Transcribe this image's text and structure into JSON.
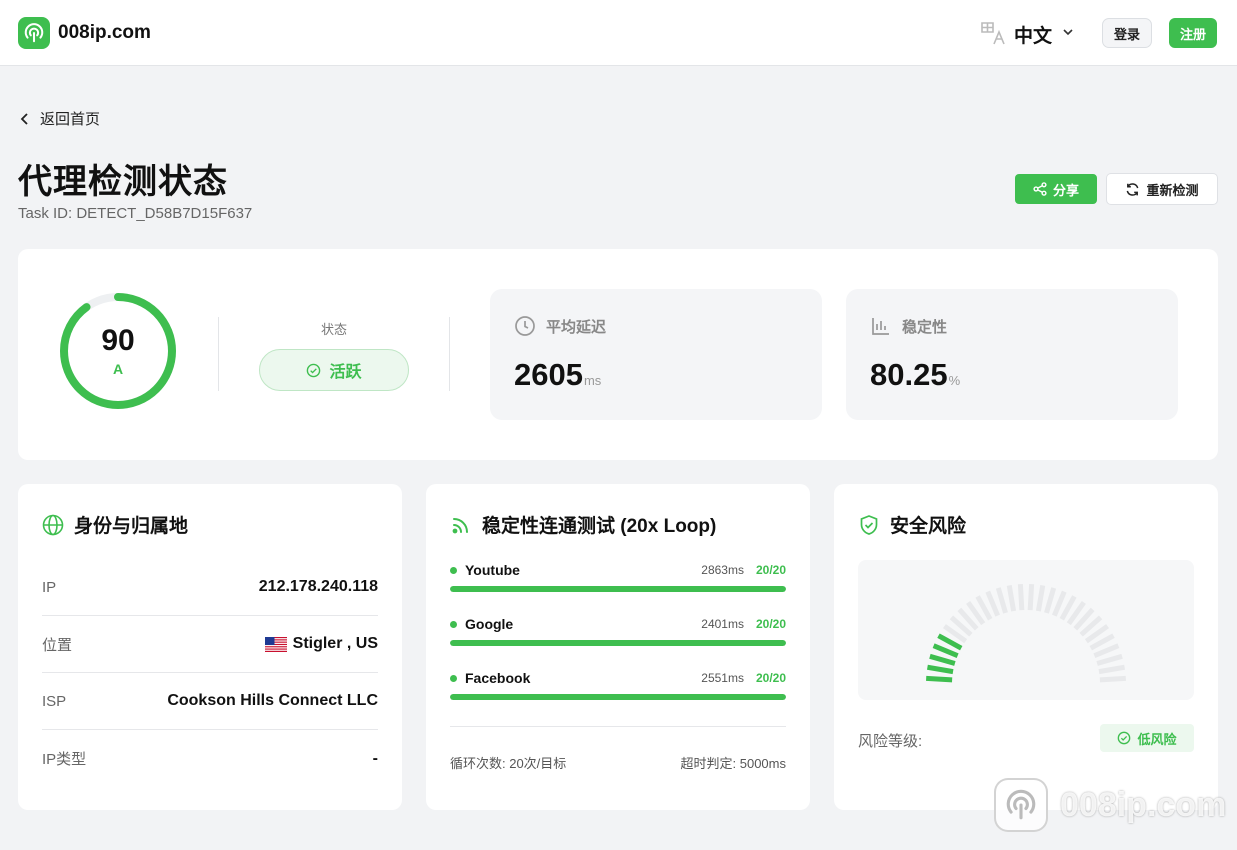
{
  "header": {
    "site_name": "008ip.com",
    "language": "中文",
    "login_label": "登录",
    "register_label": "注册"
  },
  "nav": {
    "back_label": "返回首页"
  },
  "page": {
    "title": "代理检测状态",
    "task_id": "Task ID: DETECT_D58B7D15F637",
    "share_label": "分享",
    "retest_label": "重新检测"
  },
  "summary": {
    "score": "90",
    "score_fraction": 0.9,
    "grade": "A",
    "status_label": "状态",
    "status_value": "活跃",
    "latency_label": "平均延迟",
    "latency_value": "2605",
    "latency_unit": "ms",
    "stability_label": "稳定性",
    "stability_value": "80.25",
    "stability_unit": "%"
  },
  "identity": {
    "title": "身份与归属地",
    "rows": [
      {
        "key": "IP",
        "value": "212.178.240.118"
      },
      {
        "key": "位置",
        "value": "Stigler , US"
      },
      {
        "key": "ISP",
        "value": "Cookson Hills Connect LLC"
      },
      {
        "key": "IP类型",
        "value": "-"
      }
    ]
  },
  "loop": {
    "title": "稳定性连通测试 (20x Loop)",
    "items": [
      {
        "name": "Youtube",
        "latency": "2863ms",
        "count": "20/20",
        "fraction": 1.0
      },
      {
        "name": "Google",
        "latency": "2401ms",
        "count": "20/20",
        "fraction": 1.0
      },
      {
        "name": "Facebook",
        "latency": "2551ms",
        "count": "20/20",
        "fraction": 1.0
      }
    ],
    "loop_count_label": "循环次数: 20次/目标",
    "timeout_label": "超时判定: 5000ms"
  },
  "risk": {
    "title": "安全风险",
    "level_label": "风险等级:",
    "level_value": "低风险",
    "gauge_fraction": 0.17
  },
  "colors": {
    "accent": "#3ebe4f",
    "background": "#f2f3f5"
  }
}
